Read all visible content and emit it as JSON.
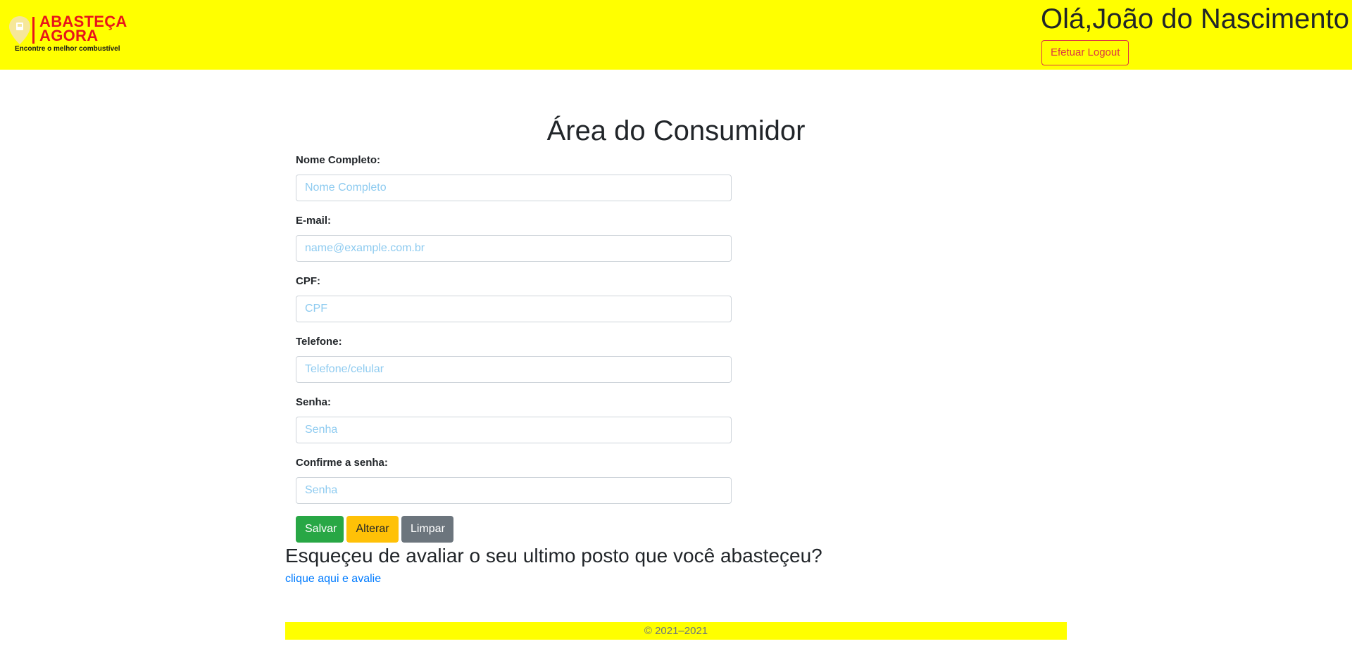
{
  "header": {
    "logo": {
      "line1": "ABASTEÇA",
      "line2": "AGORA",
      "tagline": "Encontre o melhor combustível",
      "icon": "fuel-pin-icon",
      "brand_color": "#e8141b"
    },
    "greeting": "Olá,João do Nascimento",
    "logout_label": "Efetuar Logout",
    "background_color": "#ffff00"
  },
  "main": {
    "title": "Área do Consumidor",
    "form": {
      "fields": [
        {
          "label": "Nome Completo:",
          "placeholder": "Nome Completo",
          "value": ""
        },
        {
          "label": "E-mail:",
          "placeholder": "name@example.com.br",
          "value": ""
        },
        {
          "label": "CPF:",
          "placeholder": "CPF",
          "value": ""
        },
        {
          "label": "Telefone:",
          "placeholder": "Telefone/celular",
          "value": ""
        },
        {
          "label": "Senha:",
          "placeholder": "Senha",
          "value": ""
        },
        {
          "label": "Confirme a senha:",
          "placeholder": "Senha",
          "value": ""
        }
      ],
      "buttons": {
        "save": "Salvar",
        "alter": "Alterar",
        "clear": "Limpar"
      }
    },
    "review_prompt": "Esqueçeu de avaliar o seu ultimo posto que você abasteçeu?",
    "review_link": "clique aqui e avalie"
  },
  "footer": {
    "text": "© 2021–2021"
  }
}
